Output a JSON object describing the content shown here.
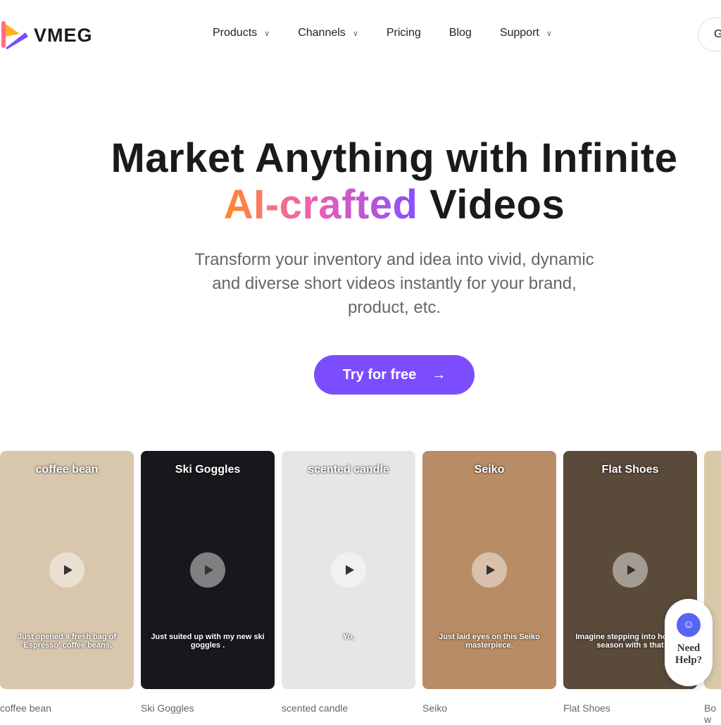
{
  "nav": {
    "brand": "VMEG",
    "items": [
      {
        "label": "Products",
        "dropdown": true
      },
      {
        "label": "Channels",
        "dropdown": true
      },
      {
        "label": "Pricing",
        "dropdown": false
      },
      {
        "label": "Blog",
        "dropdown": false
      },
      {
        "label": "Support",
        "dropdown": true
      }
    ],
    "cta_partial": "G"
  },
  "hero": {
    "title_line1": "Market Anything with Infinite",
    "title_highlight": "AI-crafted",
    "title_rest": "Videos",
    "subtitle": "Transform your inventory and idea into vivid, dynamic and diverse short videos instantly for your brand, product, etc.",
    "cta": "Try for free",
    "cta_arrow": "→"
  },
  "cards": [
    {
      "title": "coffee bean",
      "caption": "Just opened a fresh bag of 'Espresso' coffee beans,",
      "label": "coffee bean",
      "bg": "#d9c7ad"
    },
    {
      "title": "Ski Goggles",
      "caption": "Just suited up with my new ski goggles .",
      "label": "Ski Goggles",
      "bg": "#16181b"
    },
    {
      "title": "scented candle",
      "caption": "Yo,",
      "label": "scented candle",
      "bg": "#e4e6e8"
    },
    {
      "title": "Seiko",
      "caption": "Just laid eyes on this Seiko masterpiece.",
      "label": "Seiko",
      "bg": "#b88d66"
    },
    {
      "title": "Flat Shoes",
      "caption": "Imagine stepping into holiday season with s that",
      "label": "Flat Shoes",
      "bg": "#5a4a3a"
    },
    {
      "title": "",
      "caption": "",
      "label": "Bow",
      "bg": "#d8c9a8"
    }
  ],
  "help": {
    "label": "Need Help?",
    "icon": "discord-icon"
  },
  "colors": {
    "accent": "#7b4dff"
  }
}
